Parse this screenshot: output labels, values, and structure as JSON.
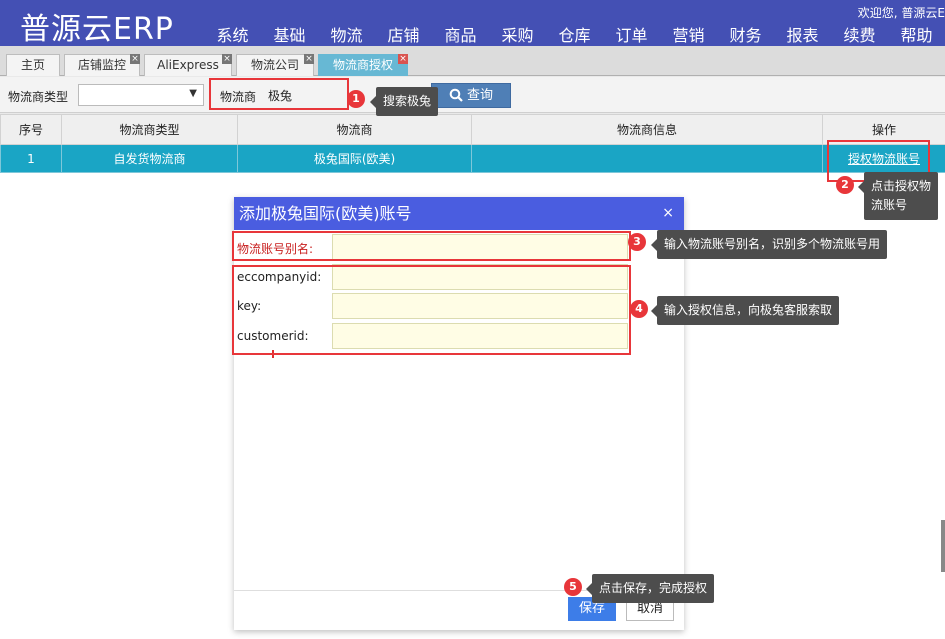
{
  "header": {
    "logo": "普源云ERP",
    "welcome": "欢迎您, 普源云E",
    "nav": [
      "系统",
      "基础",
      "物流",
      "店铺",
      "商品",
      "采购",
      "仓库",
      "订单",
      "营销",
      "财务",
      "报表",
      "续费",
      "帮助"
    ]
  },
  "tabs": [
    "主页",
    "店铺监控",
    "AliExpress",
    "物流公司",
    "物流商授权"
  ],
  "filter": {
    "type_label": "物流商类型",
    "type_value": "",
    "provider_label": "物流商",
    "provider_value": "极兔",
    "search_label": "查询"
  },
  "table": {
    "headers": [
      "序号",
      "物流商类型",
      "物流商",
      "物流商信息",
      "操作"
    ],
    "rows": [
      {
        "index": "1",
        "type": "自发货物流商",
        "provider": "极兔国际(欧美)",
        "info": "",
        "action": "授权物流账号"
      }
    ]
  },
  "dialog": {
    "title": "添加极兔国际(欧美)账号",
    "close": "×",
    "fields": [
      {
        "label": "物流账号别名:",
        "value": "",
        "required": true
      },
      {
        "label": "eccompanyid:",
        "value": "",
        "required": false
      },
      {
        "label": "key:",
        "value": "",
        "required": false
      },
      {
        "label": "customerid:",
        "value": "",
        "required": false
      }
    ],
    "save_label": "保存",
    "cancel_label": "取消"
  },
  "annotations": [
    {
      "num": "1",
      "text": "搜索极兔"
    },
    {
      "num": "2",
      "text": "点击授权物\n流账号"
    },
    {
      "num": "3",
      "text": "输入物流账号别名，识别多个物流账号用"
    },
    {
      "num": "4",
      "text": "输入授权信息，向极兔客服索取"
    },
    {
      "num": "5",
      "text": "点击保存，完成授权"
    }
  ],
  "colors": {
    "header": "#4450b4",
    "row_selected": "#1aa5c5",
    "active_tab": "#67b8d4",
    "dialog_header": "#4a5de0",
    "annotation": "#e8363a"
  }
}
